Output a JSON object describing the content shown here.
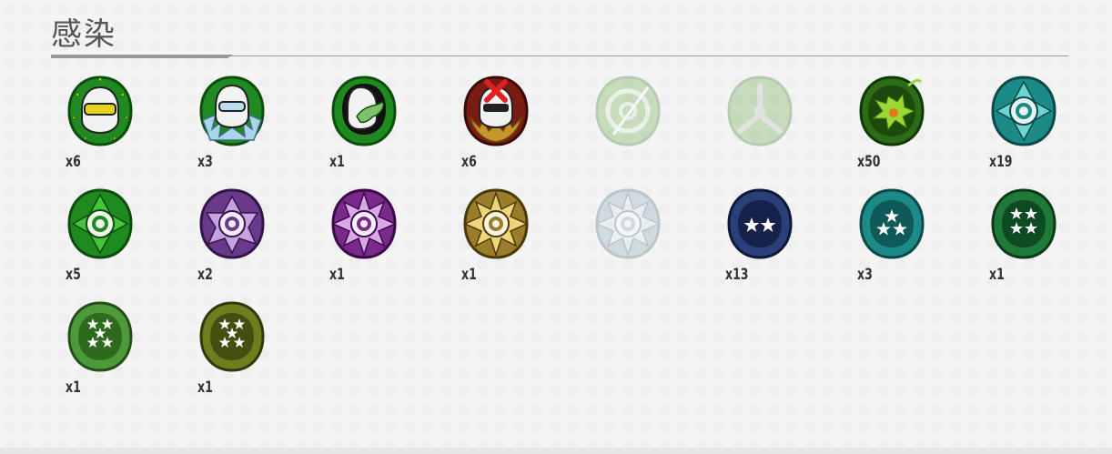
{
  "title": "感染",
  "medals": [
    {
      "icon": "helmet-visor-medal",
      "count": "x6",
      "locked": false
    },
    {
      "icon": "helmet-wings-medal",
      "count": "x3",
      "locked": false
    },
    {
      "icon": "helmet-hand-medal",
      "count": "x1",
      "locked": false
    },
    {
      "icon": "helmet-x-medal",
      "count": "x6",
      "locked": false
    },
    {
      "icon": "biohazard-slash-medal",
      "count": "",
      "locked": true
    },
    {
      "icon": "biohazard-medal",
      "count": "",
      "locked": true
    },
    {
      "icon": "infection-splat-medal",
      "count": "x50",
      "locked": false
    },
    {
      "icon": "target-teal-medal",
      "count": "x19",
      "locked": false
    },
    {
      "icon": "target-green-medal",
      "count": "x5",
      "locked": false
    },
    {
      "icon": "target-purple-medal",
      "count": "x2",
      "locked": false
    },
    {
      "icon": "target-purple-spiked-medal",
      "count": "x1",
      "locked": false
    },
    {
      "icon": "target-gold-spiked-medal",
      "count": "x1",
      "locked": false
    },
    {
      "icon": "target-silver-spiked-medal",
      "count": "",
      "locked": true
    },
    {
      "icon": "two-star-navy-medal",
      "count": "x13",
      "locked": false
    },
    {
      "icon": "three-star-teal-medal",
      "count": "x3",
      "locked": false
    },
    {
      "icon": "four-star-green-medal",
      "count": "x1",
      "locked": false
    },
    {
      "icon": "five-star-green-medal",
      "count": "x1",
      "locked": false
    },
    {
      "icon": "five-star-olive-medal",
      "count": "x1",
      "locked": false
    }
  ],
  "colors": {
    "green": "#1f8a1f",
    "dark_green": "#0d4d0d",
    "teal": "#1c8a86",
    "purple": "#6a3a8a",
    "gold": "#b8962c",
    "navy": "#2b3f7a",
    "olive": "#6f7d1c"
  }
}
